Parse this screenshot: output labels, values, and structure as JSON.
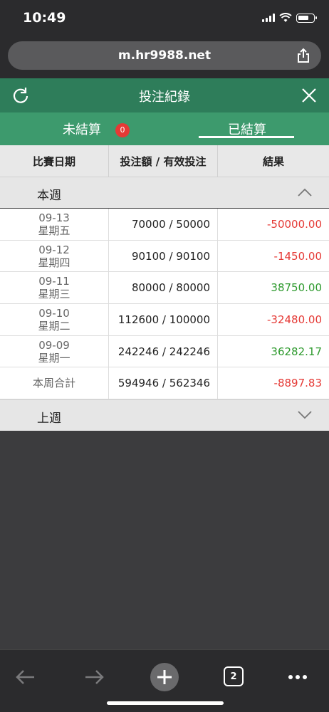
{
  "status": {
    "time": "10:49"
  },
  "browser": {
    "url": "m.hr9988.net",
    "tab_count": "2"
  },
  "header": {
    "title": "投注紀錄"
  },
  "tabs": {
    "unsettled": "未結算",
    "unsettled_count": "0",
    "settled": "已結算"
  },
  "table": {
    "headers": [
      "比賽日期",
      "投注額 / 有效投注",
      "結果"
    ],
    "this_week_label": "本週",
    "last_week_label": "上週",
    "rows": [
      {
        "date": "09-13",
        "weekday": "星期五",
        "amount": "70000 / 50000",
        "result": "-50000.00",
        "status": "neg"
      },
      {
        "date": "09-12",
        "weekday": "星期四",
        "amount": "90100 / 90100",
        "result": "-1450.00",
        "status": "neg"
      },
      {
        "date": "09-11",
        "weekday": "星期三",
        "amount": "80000 / 80000",
        "result": "38750.00",
        "status": "pos"
      },
      {
        "date": "09-10",
        "weekday": "星期二",
        "amount": "112600 / 100000",
        "result": "-32480.00",
        "status": "neg"
      },
      {
        "date": "09-09",
        "weekday": "星期一",
        "amount": "242246 / 242246",
        "result": "36282.17",
        "status": "pos"
      }
    ],
    "total": {
      "label": "本周合計",
      "amount": "594946 / 562346",
      "result": "-8897.83",
      "status": "neg"
    }
  },
  "colors": {
    "header_green": "#2e7d5a",
    "tab_green": "#3d9a6d",
    "negative": "#e53935",
    "positive": "#2e9a2e"
  }
}
